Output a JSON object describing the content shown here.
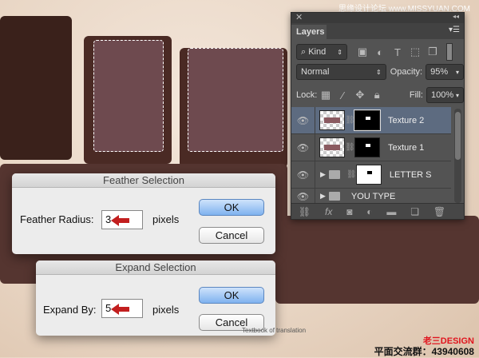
{
  "watermark_top": "思缘设计论坛 www.MISSYUAN.COM",
  "layers_panel": {
    "tab": "Layers",
    "filter_kind": "Kind",
    "blend_mode": "Normal",
    "opacity_label": "Opacity:",
    "opacity": "95%",
    "lock_label": "Lock:",
    "fill_label": "Fill:",
    "fill": "100%",
    "layers": [
      {
        "name": "Texture 2",
        "selected": true
      },
      {
        "name": "Texture 1"
      },
      {
        "name": "LETTER S"
      },
      {
        "name": "YOU TYPE"
      }
    ]
  },
  "feather": {
    "title": "Feather Selection",
    "label": "Feather Radius:",
    "value": "3",
    "unit": "pixels",
    "ok": "OK",
    "cancel": "Cancel"
  },
  "expand": {
    "title": "Expand Selection",
    "label": "Expand By:",
    "value": "5",
    "unit": "pixels",
    "ok": "OK",
    "cancel": "Cancel"
  },
  "caption": "Textbook of translation",
  "brand": "老三DESIGN",
  "group": "平面交流群：43940608",
  "colors": {
    "accent_arrow": "#c21f1f",
    "panel": "#535353",
    "selected_layer": "#5d6b80"
  }
}
